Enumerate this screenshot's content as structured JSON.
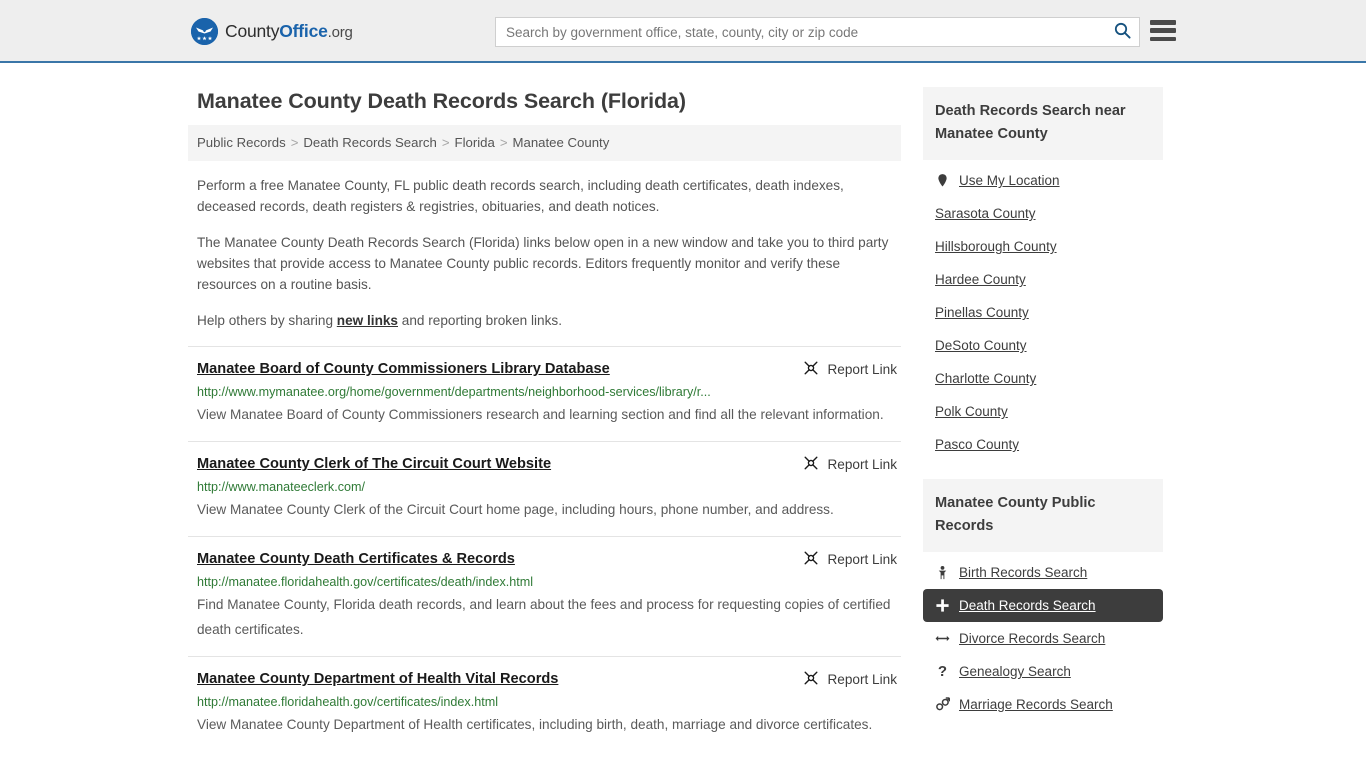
{
  "header": {
    "brand": {
      "part1": "County",
      "part2": "Office",
      "part3": ".org",
      "logo_icon": "eagle-seal-icon"
    },
    "search": {
      "placeholder": "Search by government office, state, county, city or zip code",
      "value": "",
      "icon": "search-icon"
    },
    "menu_icon": "hamburger-menu-icon"
  },
  "main": {
    "title": "Manatee County Death Records Search (Florida)",
    "breadcrumb": [
      {
        "label": "Public Records"
      },
      {
        "label": "Death Records Search"
      },
      {
        "label": "Florida"
      },
      {
        "label": "Manatee County"
      }
    ],
    "breadcrumb_separator": ">",
    "intro": {
      "p1": "Perform a free Manatee County, FL public death records search, including death certificates, death indexes, deceased records, death registers & registries, obituaries, and death notices.",
      "p2": "The Manatee County Death Records Search (Florida) links below open in a new window and take you to third party websites that provide access to Manatee County public records. Editors frequently monitor and verify these resources on a routine basis.",
      "p3_before": "Help others by sharing ",
      "p3_link": "new links",
      "p3_after": " and reporting broken links."
    },
    "report_link_label": "Report Link",
    "report_link_icon": "broken-link-icon",
    "results": [
      {
        "title": "Manatee Board of County Commissioners Library Database",
        "url": "http://www.mymanatee.org/home/government/departments/neighborhood-services/library/r...",
        "description": "View Manatee Board of County Commissioners research and learning section and find all the relevant information."
      },
      {
        "title": "Manatee County Clerk of The Circuit Court Website",
        "url": "http://www.manateeclerk.com/",
        "description": "View Manatee County Clerk of the Circuit Court home page, including hours, phone number, and address."
      },
      {
        "title": "Manatee County Death Certificates & Records",
        "url": "http://manatee.floridahealth.gov/certificates/death/index.html",
        "description": "Find Manatee County, Florida death records, and learn about the fees and process for requesting copies of certified death certificates."
      },
      {
        "title": "Manatee County Department of Health Vital Records",
        "url": "http://manatee.floridahealth.gov/certificates/index.html",
        "description": "View Manatee County Department of Health certificates, including birth, death, marriage and divorce certificates."
      }
    ]
  },
  "sidebar": {
    "nearby": {
      "heading": "Death Records Search near Manatee County",
      "items": [
        {
          "label": "Use My Location",
          "icon": "map-pin-icon",
          "active": false
        },
        {
          "label": "Sarasota County",
          "icon": "",
          "active": false
        },
        {
          "label": "Hillsborough County",
          "icon": "",
          "active": false
        },
        {
          "label": "Hardee County",
          "icon": "",
          "active": false
        },
        {
          "label": "Pinellas County",
          "icon": "",
          "active": false
        },
        {
          "label": "DeSoto County",
          "icon": "",
          "active": false
        },
        {
          "label": "Charlotte County",
          "icon": "",
          "active": false
        },
        {
          "label": "Polk County",
          "icon": "",
          "active": false
        },
        {
          "label": "Pasco County",
          "icon": "",
          "active": false
        }
      ]
    },
    "public_records": {
      "heading": "Manatee County Public Records",
      "items": [
        {
          "label": "Birth Records Search",
          "icon": "baby-icon",
          "active": false
        },
        {
          "label": "Death Records Search",
          "icon": "cross-icon",
          "active": true
        },
        {
          "label": "Divorce Records Search",
          "icon": "split-arrows-icon",
          "active": false
        },
        {
          "label": "Genealogy Search",
          "icon": "question-mark-icon",
          "active": false
        },
        {
          "label": "Marriage Records Search",
          "icon": "male-female-icon",
          "active": false
        }
      ]
    }
  },
  "colors": {
    "brand_blue": "#1a63ab",
    "header_bg": "#eeeeee",
    "header_border": "#3a76a8",
    "url_green": "#2f7a36",
    "active_bg": "#3d3d3d",
    "panel_bg": "#f4f4f4"
  }
}
